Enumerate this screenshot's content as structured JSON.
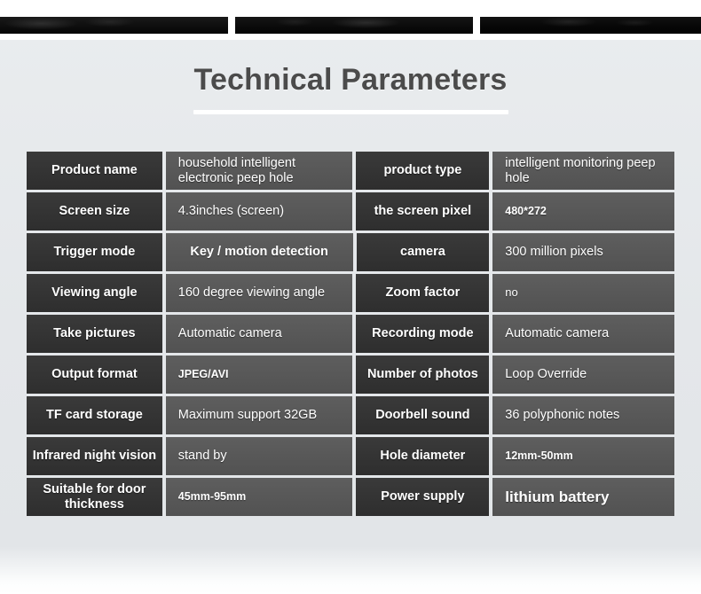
{
  "header": {
    "title": "Technical Parameters"
  },
  "top_strip": {
    "segments": [
      "photo-strip-left",
      "photo-strip-center",
      "photo-strip-right"
    ]
  },
  "table": {
    "rows": [
      {
        "label_left": "Product name",
        "value_left": "household intelligent electronic peep hole",
        "label_right": "product type",
        "value_right": "intelligent monitoring peep hole"
      },
      {
        "label_left": "Screen size",
        "value_left": "4.3inches (screen)",
        "label_right": "the screen pixel",
        "value_right": "480*272"
      },
      {
        "label_left": "Trigger mode",
        "value_left": "Key / motion detection",
        "label_right": "camera",
        "value_right": "300 million pixels"
      },
      {
        "label_left": "Viewing angle",
        "value_left": "160 degree viewing angle",
        "label_right": "Zoom factor",
        "value_right": "no"
      },
      {
        "label_left": "Take pictures",
        "value_left": "Automatic camera",
        "label_right": "Recording mode",
        "value_right": "Automatic camera"
      },
      {
        "label_left": "Output format",
        "value_left": "JPEG/AVI",
        "label_right": "Number of photos",
        "value_right": "Loop Override"
      },
      {
        "label_left": "TF card storage",
        "value_left": "Maximum support 32GB",
        "label_right": "Doorbell sound",
        "value_right": "36 polyphonic notes"
      },
      {
        "label_left": "Infrared night vision",
        "value_left": "stand by",
        "label_right": "Hole diameter",
        "value_right": "12mm-50mm"
      },
      {
        "label_left": "Suitable for door thickness",
        "value_left": "45mm-95mm",
        "label_right": "Power supply",
        "value_right": "lithium battery"
      }
    ]
  },
  "colors": {
    "background": "#e4e7ea",
    "label_cell": "#343434",
    "value_cell": "#585858",
    "title_text": "#4b4b4b",
    "cell_text": "#ffffff",
    "rule": "#ffffff"
  }
}
